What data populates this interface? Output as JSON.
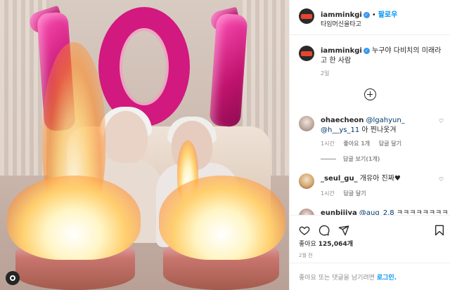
{
  "header": {
    "username": "iamminkgi",
    "verified_mark": "✓",
    "separator": "•",
    "follow_label": "팔로우",
    "location": "타임머신을타고"
  },
  "caption": {
    "username": "iamminkgi",
    "verified_mark": "✓",
    "text": "누구야 다비치의 미래라고 한 사람",
    "time": "2일"
  },
  "comments": [
    {
      "username": "ohaecheon",
      "mentions": [
        "@lgahyun_",
        "@h__ys_11"
      ],
      "text": "아 찐나옷겨",
      "time": "1시간",
      "likes": "좋아요 1개",
      "reply_label": "답글 달기",
      "view_replies": "답글 보기(1개)"
    },
    {
      "username": "_seul_gu_",
      "text": "개유아 진짜♥",
      "time": "1시간",
      "reply_label": "답글 달기"
    },
    {
      "username": "eunbijiya",
      "mention": "@aug_2.8",
      "text": "ㅋㅋㅋㅋㅋㅋㅋㅋㅋ"
    }
  ],
  "actions": {
    "likes_label": "좋아요",
    "likes_count": "125,064개",
    "date": "2월 전"
  },
  "add_comment": {
    "placeholder": "좋아요 또는 댓글을 남기려면",
    "login_label": "로그인."
  },
  "photo": {
    "balloon_text": "101"
  },
  "icons": [
    "heart-icon",
    "comment-icon",
    "share-icon",
    "bookmark-icon",
    "add-circle-icon",
    "verified-icon",
    "camera-icon"
  ],
  "colors": {
    "accent": "#0095f6",
    "balloon": "#d2197f",
    "border": "#efefef"
  }
}
